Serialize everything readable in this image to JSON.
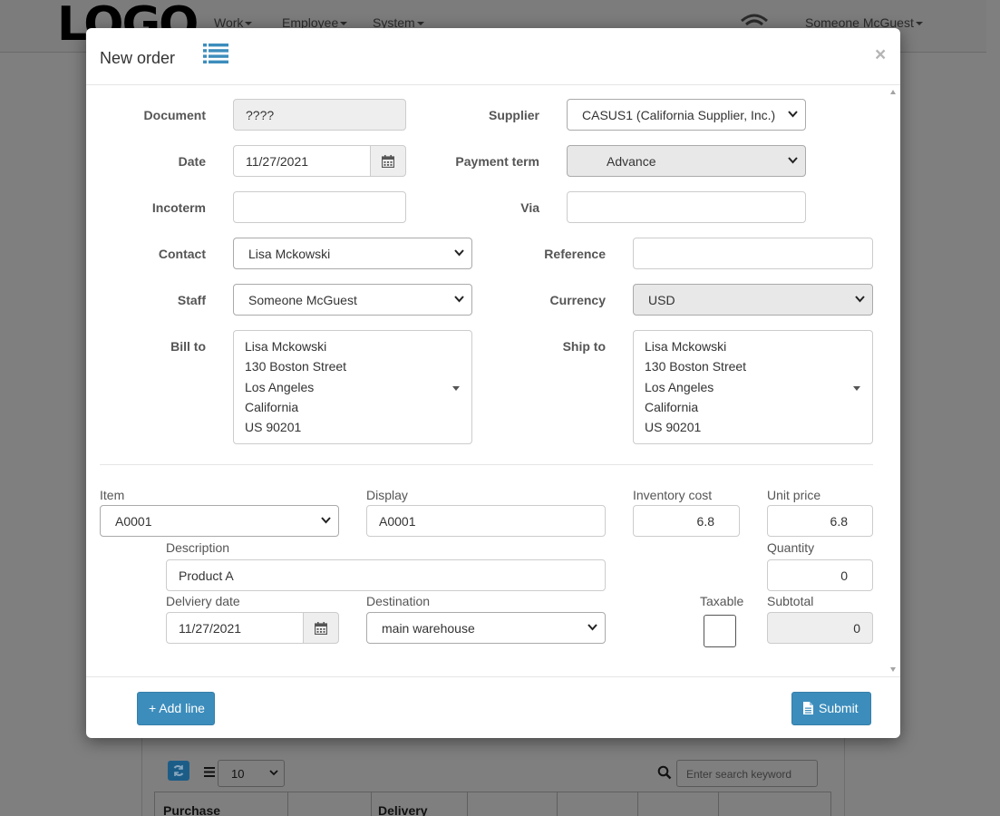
{
  "navbar": {
    "logo": "LOGO",
    "menus": [
      {
        "label": "Work"
      },
      {
        "label": "Employee"
      },
      {
        "label": "System"
      }
    ],
    "user": "Someone McGuest"
  },
  "background": {
    "page_size": "10",
    "search_placeholder": "Enter search keyword",
    "table_headers": [
      "Purchase",
      "",
      "Delivery",
      "",
      "",
      "",
      ""
    ]
  },
  "modal": {
    "title": "New order",
    "close": "×",
    "header_fields": {
      "document": {
        "label": "Document",
        "value": "????"
      },
      "supplier": {
        "label": "Supplier",
        "value": "CASUS1 (California Supplier, Inc.)"
      },
      "date": {
        "label": "Date",
        "value": "11/27/2021"
      },
      "payment_term": {
        "label": "Payment term",
        "value": "Advance"
      },
      "incoterm": {
        "label": "Incoterm",
        "value": ""
      },
      "via": {
        "label": "Via",
        "value": ""
      },
      "contact": {
        "label": "Contact",
        "value": "Lisa Mckowski"
      },
      "reference": {
        "label": "Reference",
        "value": ""
      },
      "staff": {
        "label": "Staff",
        "value": "Someone McGuest"
      },
      "currency": {
        "label": "Currency",
        "value": "USD"
      },
      "bill_to": {
        "label": "Bill to",
        "lines": [
          "Lisa Mckowski",
          "130 Boston Street",
          "Los Angeles",
          "California",
          "US 90201"
        ]
      },
      "ship_to": {
        "label": "Ship to",
        "lines": [
          "Lisa Mckowski",
          "130 Boston Street",
          "Los Angeles",
          "California",
          "US 90201"
        ]
      }
    },
    "line_item": {
      "item": {
        "label": "Item",
        "value": "A0001"
      },
      "display": {
        "label": "Display",
        "value": "A0001"
      },
      "inventory_cost": {
        "label": "Inventory cost",
        "value": "6.8"
      },
      "unit_price": {
        "label": "Unit price",
        "value": "6.8"
      },
      "description": {
        "label": "Description",
        "value": "Product A"
      },
      "quantity": {
        "label": "Quantity",
        "value": "0"
      },
      "delivery_date": {
        "label": "Delviery date",
        "value": "11/27/2021"
      },
      "destination": {
        "label": "Destination",
        "value": "main warehouse"
      },
      "taxable": {
        "label": "Taxable",
        "checked": false
      },
      "subtotal": {
        "label": "Subtotal",
        "value": "0"
      }
    },
    "footer": {
      "add_line": "+ Add line",
      "submit": "Submit"
    }
  },
  "colors": {
    "primary": "#3c8dbc",
    "list_icon": "#3c8dbc",
    "backdrop": "#7f7f7f"
  }
}
